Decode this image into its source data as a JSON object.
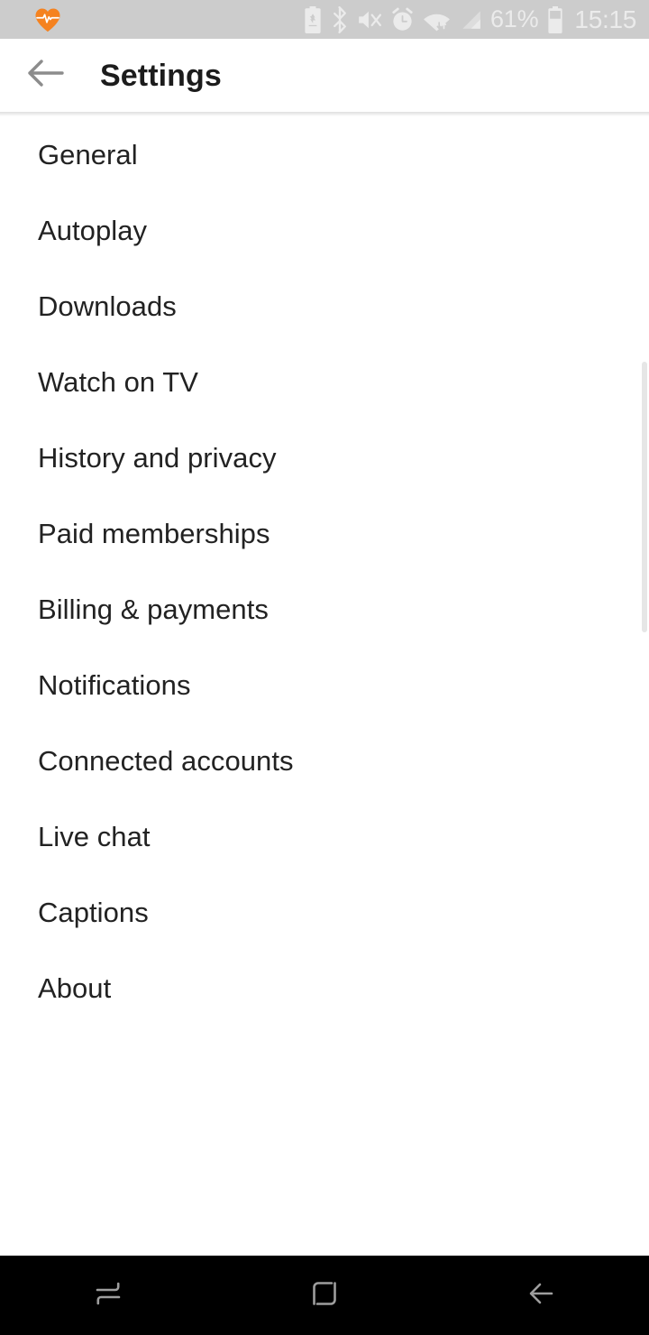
{
  "status_bar": {
    "background_color": "#cccccc",
    "icon_color": "#ebebeb",
    "notification_icons": [
      {
        "name": "health-heartbeat-icon",
        "color": "#f5821f"
      }
    ],
    "system_icons": [
      {
        "name": "battery-saver-icon"
      },
      {
        "name": "bluetooth-icon"
      },
      {
        "name": "volume-mute-icon"
      },
      {
        "name": "alarm-clock-icon"
      },
      {
        "name": "wifi-icon"
      },
      {
        "name": "cellular-signal-icon"
      }
    ],
    "battery_percent": "61%",
    "clock": "15:15"
  },
  "app_bar": {
    "title": "Settings",
    "back_icon": "arrow-left-icon",
    "back_icon_color": "#8c8c8c",
    "title_color": "#1c1c1c",
    "background_color": "#ffffff"
  },
  "settings": {
    "items": [
      {
        "label": "General"
      },
      {
        "label": "Autoplay"
      },
      {
        "label": "Downloads"
      },
      {
        "label": "Watch on TV"
      },
      {
        "label": "History and privacy"
      },
      {
        "label": "Paid memberships"
      },
      {
        "label": "Billing & payments"
      },
      {
        "label": "Notifications"
      },
      {
        "label": "Connected accounts"
      },
      {
        "label": "Live chat"
      },
      {
        "label": "Captions"
      },
      {
        "label": "About"
      }
    ],
    "text_color": "#222222",
    "background_color": "#ffffff"
  },
  "scrollbar": {
    "thumb_color": "#e6e6e6"
  },
  "nav_bar": {
    "background_color": "#000000",
    "icon_color": "#9e9e9e",
    "buttons": [
      {
        "name": "recents-icon"
      },
      {
        "name": "home-icon"
      },
      {
        "name": "back-icon"
      }
    ]
  }
}
